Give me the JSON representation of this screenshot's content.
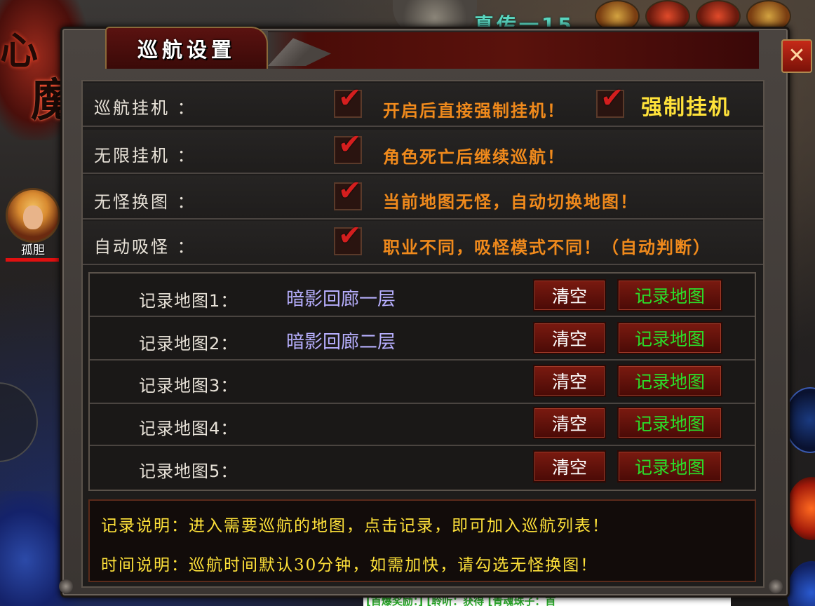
{
  "colors": {
    "accent_orange": "#f08a1c",
    "note_yellow": "#ffe23a",
    "record_green": "#2adf2a",
    "map_lilac": "#b8b0ff",
    "check_red": "#d41e1e"
  },
  "background": {
    "player_name": "孤胆",
    "logo_chars": [
      "心",
      "魔"
    ],
    "top_banner": "真传一15",
    "chat_text": "[首爆奖励：] [聆听：获得 [青魂珠子：首"
  },
  "dialog": {
    "title": "巡航设置",
    "close_icon": "close-icon",
    "settings": [
      {
        "label": "巡航挂机 ：",
        "checked": true,
        "desc": "开启后直接强制挂机！",
        "extra_checked": true,
        "extra_label": "强制挂机"
      },
      {
        "label": "无限挂机 ：",
        "checked": true,
        "desc": "角色死亡后继续巡航！"
      },
      {
        "label": "无怪换图 ：",
        "checked": true,
        "desc": "当前地图无怪，自动切换地图！"
      },
      {
        "label": "自动吸怪 ：",
        "checked": true,
        "desc": "职业不同，吸怪模式不同！（自动判断）"
      }
    ],
    "records": [
      {
        "label": "记录地图1：",
        "map": "暗影回廊一层",
        "clear": "清空",
        "record": "记录地图"
      },
      {
        "label": "记录地图2：",
        "map": "暗影回廊二层",
        "clear": "清空",
        "record": "记录地图"
      },
      {
        "label": "记录地图3：",
        "map": "",
        "clear": "清空",
        "record": "记录地图"
      },
      {
        "label": "记录地图4：",
        "map": "",
        "clear": "清空",
        "record": "记录地图"
      },
      {
        "label": "记录地图5：",
        "map": "",
        "clear": "清空",
        "record": "记录地图"
      }
    ],
    "notes": [
      "记录说明：进入需要巡航的地图，点击记录，即可加入巡航列表！",
      "时间说明：巡航时间默认30分钟，如需加快，请勾选无怪换图！"
    ],
    "tick_glyph": "✔"
  }
}
